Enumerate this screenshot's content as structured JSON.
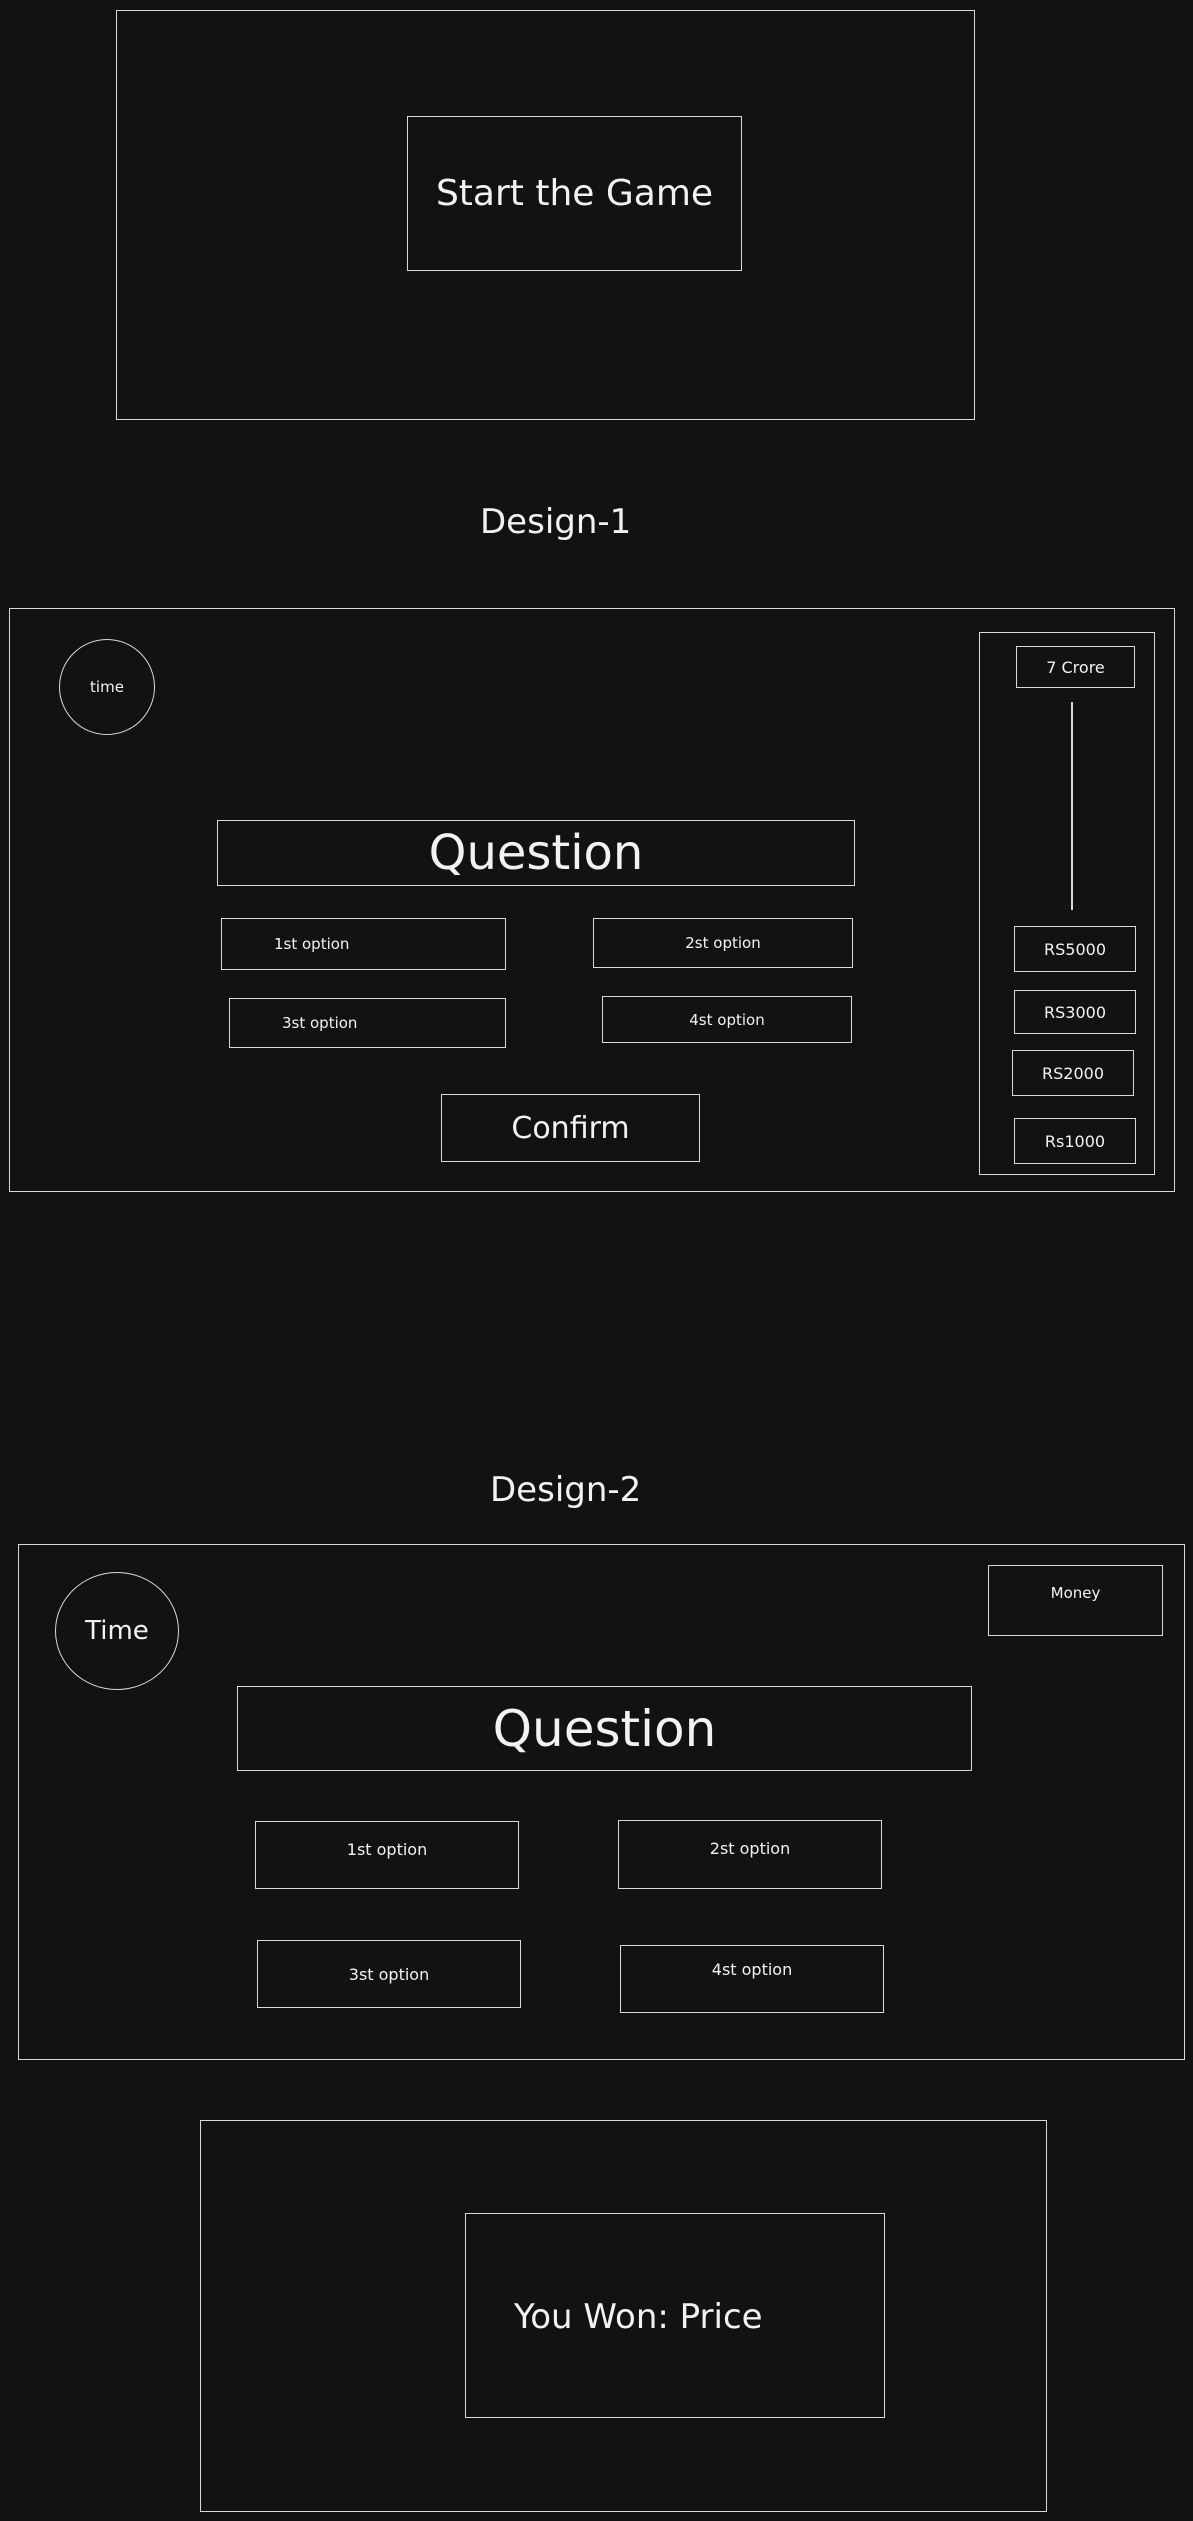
{
  "start_screen": {
    "button_label": "Start the Game"
  },
  "design1": {
    "heading": "Design-1",
    "timer_label": "time",
    "question_label": "Question",
    "options": [
      "1st option",
      "2st option",
      "3st option",
      "4st option"
    ],
    "confirm_label": "Confirm",
    "prize_ladder": {
      "top": "7 Crore",
      "levels": [
        "RS5000",
        "RS3000",
        "RS2000",
        "Rs1000"
      ]
    }
  },
  "design2": {
    "heading": "Design-2",
    "timer_label": "Time",
    "money_label": "Money",
    "question_label": "Question",
    "options": [
      "1st option",
      "2st option",
      "3st option",
      "4st option"
    ]
  },
  "end_screen": {
    "result_label": "You Won: Price"
  }
}
